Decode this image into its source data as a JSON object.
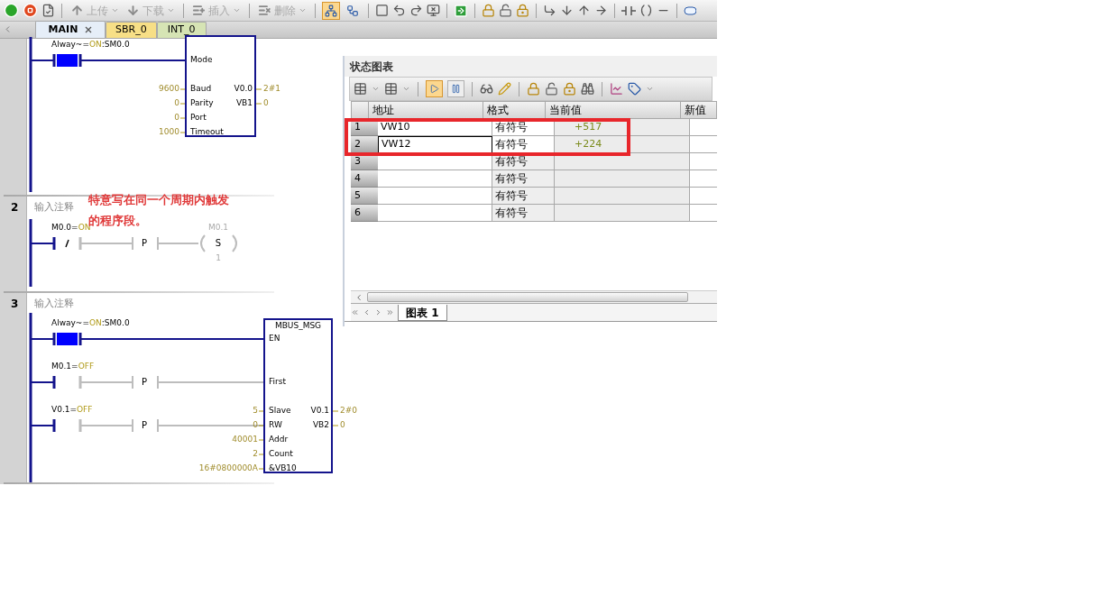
{
  "toolbar": {
    "buttons": [
      {
        "label": "上传",
        "disabled": true
      },
      {
        "label": "下载",
        "disabled": true
      },
      {
        "label": "插入",
        "disabled": true
      },
      {
        "label": "删除",
        "disabled": true
      }
    ],
    "toggles": [
      {
        "selected": true
      },
      {
        "selected": false
      }
    ]
  },
  "tabs": [
    {
      "label": "MAIN",
      "selected": true,
      "color": "#e6eef8"
    },
    {
      "label": "SBR_0",
      "selected": false,
      "color": "#f7df86"
    },
    {
      "label": "INT_0",
      "selected": false,
      "color": "#d6e4b4"
    }
  ],
  "networks": [
    {
      "kind": "block",
      "contacts": [
        {
          "symbol": "Alway~=",
          "state_text": "ON",
          "address": ":SM0.0",
          "kind": "no",
          "on": true
        }
      ],
      "block": {
        "inputs": [
          {
            "pin": "Mode"
          },
          {
            "pin": "Baud",
            "value": "9600"
          },
          {
            "pin": "Parity",
            "value": "0"
          },
          {
            "pin": "Port",
            "value": "0"
          },
          {
            "pin": "Timeout",
            "value": "1000"
          }
        ],
        "outputs": [
          {
            "pin": "V0.0",
            "value": "2#1"
          },
          {
            "pin": "VB1",
            "value": "0"
          }
        ]
      }
    },
    {
      "kind": "coil",
      "number": "2",
      "comment": "输入注释",
      "note_lines": [
        "特意写在同一个周期内触发",
        "的程序段。"
      ],
      "contacts": [
        {
          "symbol": "M0.0=",
          "state_text": "ON",
          "kind": "nc",
          "on": true,
          "edge": "P"
        }
      ],
      "coil": {
        "address": "M0.1",
        "op": "S",
        "count": "1",
        "on": false
      }
    },
    {
      "kind": "block",
      "number": "3",
      "comment": "输入注释",
      "contacts": [
        {
          "symbol": "Alway~=",
          "state_text": "ON",
          "address": ":SM0.0",
          "kind": "no",
          "on": true
        },
        {
          "symbol": "M0.1=",
          "state_text": "OFF",
          "kind": "no",
          "on": false,
          "edge": "P"
        },
        {
          "symbol": "V0.1=",
          "state_text": "OFF",
          "kind": "no",
          "on": false,
          "edge": "P"
        }
      ],
      "block": {
        "title": "MBUS_MSG",
        "inputs": [
          {
            "pin": "EN"
          },
          {
            "pin": "First"
          },
          {
            "pin": "Slave",
            "value": "5"
          },
          {
            "pin": "RW",
            "value": "0"
          },
          {
            "pin": "Addr",
            "value": "40001"
          },
          {
            "pin": "Count",
            "value": "2"
          },
          {
            "pin": "&VB10",
            "value": "16#0800000A"
          }
        ],
        "outputs": [
          {
            "pin": "V0.1",
            "value": "2#0"
          },
          {
            "pin": "VB2",
            "value": "0"
          }
        ]
      }
    }
  ],
  "status_chart": {
    "title": "状态图表",
    "toggles": [
      {
        "selected": true
      },
      {
        "selected": false
      }
    ],
    "columns": [
      "地址",
      "格式",
      "当前值",
      "新值"
    ],
    "rows": [
      {
        "index": "1",
        "address": "VW10",
        "format": "有符号",
        "value": "+517",
        "selected": false,
        "highlighted": true
      },
      {
        "index": "2",
        "address": "VW12",
        "format": "有符号",
        "value": "+224",
        "selected": true,
        "highlighted": true
      },
      {
        "index": "3",
        "format": "有符号",
        "selected": false,
        "highlighted": false
      },
      {
        "index": "4",
        "format": "有符号",
        "selected": false,
        "highlighted": false
      },
      {
        "index": "5",
        "format": "有符号",
        "selected": false,
        "highlighted": false
      },
      {
        "index": "6",
        "format": "有符号",
        "selected": false,
        "highlighted": false
      }
    ],
    "sheet_tabs": [
      {
        "label": "图表 1",
        "selected": true
      }
    ]
  }
}
